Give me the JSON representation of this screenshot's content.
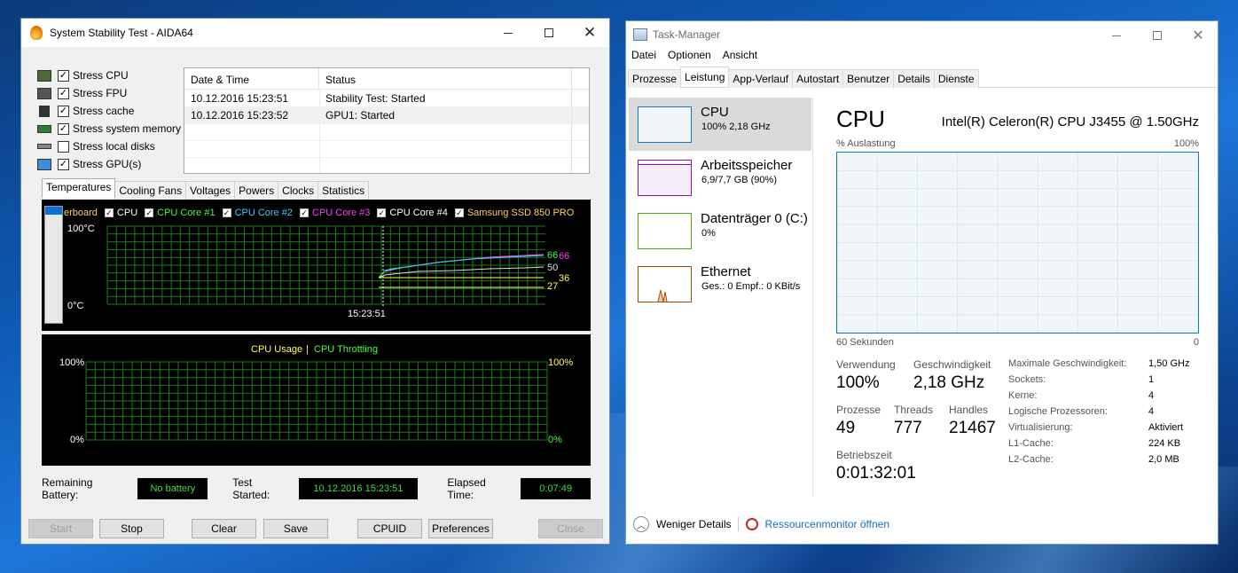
{
  "aida": {
    "title": "System Stability Test - AIDA64",
    "checks": [
      {
        "label": "Stress CPU",
        "checked": true,
        "icon": "cpu-chip-icon"
      },
      {
        "label": "Stress FPU",
        "checked": true,
        "icon": "fpu-chip-icon"
      },
      {
        "label": "Stress cache",
        "checked": true,
        "icon": "cache-chip-icon"
      },
      {
        "label": "Stress system memory",
        "checked": true,
        "icon": "memory-module-icon"
      },
      {
        "label": "Stress local disks",
        "checked": false,
        "icon": "disk-drive-icon"
      },
      {
        "label": "Stress GPU(s)",
        "checked": true,
        "icon": "monitor-icon"
      }
    ],
    "log": {
      "headers": [
        "Date & Time",
        "Status"
      ],
      "rows": [
        {
          "time": "10.12.2016 15:23:51",
          "status": "Stability Test: Started"
        },
        {
          "time": "10.12.2016 15:23:52",
          "status": "GPU1: Started"
        }
      ]
    },
    "tabs": [
      "Temperatures",
      "Cooling Fans",
      "Voltages",
      "Powers",
      "Clocks",
      "Statistics"
    ],
    "temp_legend": [
      {
        "label": "erboard",
        "color": "#ffffff",
        "checkbox": false
      },
      {
        "label": "CPU",
        "color": "#ffffff",
        "checkbox": true
      },
      {
        "label": "CPU Core #1",
        "color": "#3cff3c",
        "checkbox": true
      },
      {
        "label": "CPU Core #2",
        "color": "#3cc8ff",
        "checkbox": true
      },
      {
        "label": "CPU Core #3",
        "color": "#ff3cff",
        "checkbox": true
      },
      {
        "label": "CPU Core #4",
        "color": "#ffffff",
        "checkbox": true
      },
      {
        "label": "Samsung SSD 850 PRO",
        "color": "#ffd060",
        "checkbox": true
      }
    ],
    "temp_axis": {
      "top": "100°C",
      "bottom": "0°C",
      "time": "15:23:51"
    },
    "temp_end_labels": [
      {
        "text": "66",
        "color": "#3cff3c"
      },
      {
        "text": "66",
        "color": "#ff3cff"
      },
      {
        "text": "50",
        "color": "#dddddd"
      },
      {
        "text": "36",
        "color": "#ffff50"
      },
      {
        "text": "27",
        "color": "#ffff50"
      }
    ],
    "usage_legend": {
      "usage": "CPU Usage",
      "sep": "|",
      "throttle": "CPU Throttling"
    },
    "usage_axis": {
      "left_top": "100%",
      "left_bottom": "0%",
      "right_top": "100%",
      "right_bottom": "0%"
    },
    "status": {
      "battery_label": "Remaining Battery:",
      "battery_value": "No battery",
      "started_label": "Test Started:",
      "started_value": "10.12.2016 15:23:51",
      "elapsed_label": "Elapsed Time:",
      "elapsed_value": "0:07:49"
    },
    "buttons": {
      "start": "Start",
      "stop": "Stop",
      "clear": "Clear",
      "save": "Save",
      "cpuid": "CPUID",
      "preferences": "Preferences",
      "close": "Close"
    }
  },
  "tm": {
    "title": "Task-Manager",
    "menu": [
      "Datei",
      "Optionen",
      "Ansicht"
    ],
    "tabs": [
      "Prozesse",
      "Leistung",
      "App-Verlauf",
      "Autostart",
      "Benutzer",
      "Details",
      "Dienste"
    ],
    "left": [
      {
        "name": "CPU",
        "sub": "100% 2,18 GHz",
        "color": "#117dbb"
      },
      {
        "name": "Arbeitsspeicher",
        "sub": "6,9/7,7 GB (90%)",
        "color": "#8b12ae"
      },
      {
        "name": "Datenträger 0 (C:)",
        "sub": "0%",
        "color": "#4da60c"
      },
      {
        "name": "Ethernet",
        "sub": "Ges.: 0 Empf.: 0 KBit/s",
        "color": "#a74f01"
      }
    ],
    "header": {
      "title": "CPU",
      "model": "Intel(R) Celeron(R) CPU J3455 @ 1.50GHz"
    },
    "graph": {
      "ylabel": "% Auslastung",
      "ymax": "100%",
      "xlabel": "60 Sekunden",
      "xmin": "0"
    },
    "stats": {
      "verwendung_label": "Verwendung",
      "verwendung": "100%",
      "geschw_label": "Geschwindigkeit",
      "geschw": "2,18 GHz",
      "prozesse_label": "Prozesse",
      "prozesse": "49",
      "threads_label": "Threads",
      "threads": "777",
      "handles_label": "Handles",
      "handles": "21467",
      "betrieb_label": "Betriebszeit",
      "betrieb": "0:01:32:01"
    },
    "details": [
      {
        "k": "Maximale Geschwindigkeit:",
        "v": "1,50 GHz"
      },
      {
        "k": "Sockets:",
        "v": "1"
      },
      {
        "k": "Kerne:",
        "v": "4"
      },
      {
        "k": "Logische Prozessoren:",
        "v": "4"
      },
      {
        "k": "Virtualisierung:",
        "v": "Aktiviert"
      },
      {
        "k": "L1-Cache:",
        "v": "224 KB"
      },
      {
        "k": "L2-Cache:",
        "v": "2,0 MB"
      }
    ],
    "footer": {
      "less": "Weniger Details",
      "resmon": "Ressourcenmonitor öffnen"
    }
  }
}
